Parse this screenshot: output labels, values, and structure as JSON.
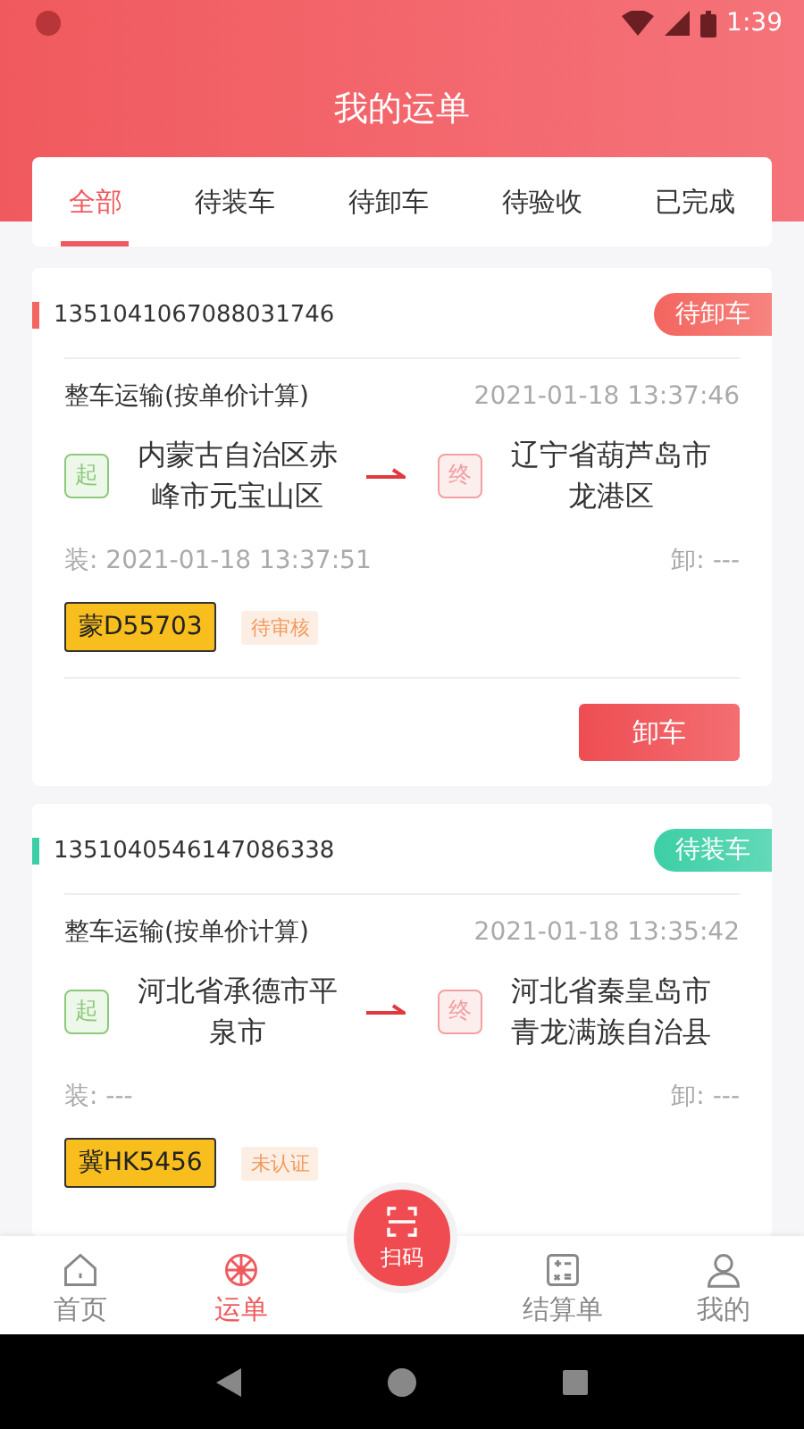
{
  "status_bar": {
    "time": "1:39"
  },
  "title": "我的运单",
  "tabs": [
    {
      "label": "全部",
      "selected": true
    },
    {
      "label": "待装车",
      "selected": false
    },
    {
      "label": "待卸车",
      "selected": false
    },
    {
      "label": "待验收",
      "selected": false
    },
    {
      "label": "已完成",
      "selected": false
    }
  ],
  "orders": [
    {
      "number": "1351041067088031746",
      "status": "待卸车",
      "color": "#f4655f",
      "type": "整车运输(按单价计算)",
      "created": "2021-01-18 13:37:46",
      "origin_mark": "起",
      "origin": "内蒙古自治区赤峰市元宝山区",
      "dest_mark": "终",
      "destination": "辽宁省葫芦岛市龙港区",
      "loaded": "装: 2021-01-18 13:37:51",
      "unloaded": "卸: ---",
      "plate": "蒙D55703",
      "review": "待审核",
      "action": "卸车"
    },
    {
      "number": "1351040546147086338",
      "status": "待装车",
      "color": "#3ccfa6",
      "type": "整车运输(按单价计算)",
      "created": "2021-01-18 13:35:42",
      "origin_mark": "起",
      "origin": "河北省承德市平泉市",
      "dest_mark": "终",
      "destination": "河北省秦皇岛市青龙满族自治县",
      "loaded": "装: ---",
      "unloaded": "卸: ---",
      "plate": "冀HK5456",
      "review": "未认证"
    }
  ],
  "nav": [
    {
      "label": "首页",
      "kind": "home",
      "selected": false
    },
    {
      "label": "运单",
      "kind": "waybill",
      "selected": true
    },
    {
      "label": "扫码",
      "kind": "scan"
    },
    {
      "label": "结算单",
      "kind": "bill",
      "selected": false
    },
    {
      "label": "我的",
      "kind": "profile",
      "selected": false
    }
  ]
}
